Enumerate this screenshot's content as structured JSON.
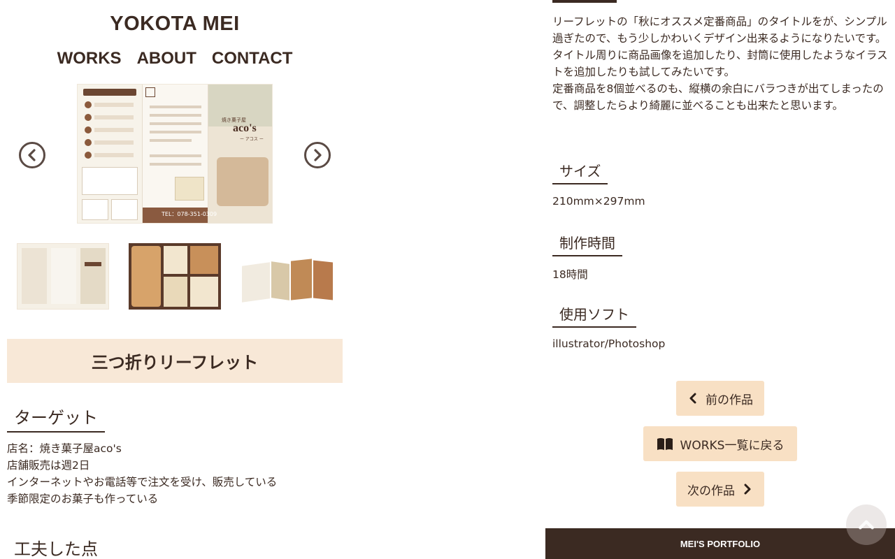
{
  "site": {
    "title": "YOKOTA MEI"
  },
  "nav": {
    "items": [
      {
        "label": "WORKS"
      },
      {
        "label": "ABOUT"
      },
      {
        "label": "CONTACT"
      }
    ]
  },
  "carousel": {
    "prev_icon": "chevron-left-icon",
    "next_icon": "chevron-right-icon",
    "main_image": {
      "shop_name": "aco's",
      "shop_sub": "焼き菓子屋",
      "shop_kana": "ー アコス ー",
      "tel": "TEL：078-351-0309"
    },
    "thumbnails": [
      {
        "name": "leaflet-outside"
      },
      {
        "name": "leaflet-inside"
      },
      {
        "name": "leaflet-folded"
      }
    ]
  },
  "work": {
    "title": "三つ折りリーフレット"
  },
  "target": {
    "heading": "ターゲット",
    "lines": [
      "店名：焼き菓子屋aco's",
      "店舗販売は週2日",
      "インターネットやお電話等で注文を受け、販売している",
      "季節限定のお菓子も作っている"
    ]
  },
  "ideas": {
    "heading": "工夫した点"
  },
  "description": {
    "paragraphs": [
      "リーフレットの「秋にオススメ定番商品」のタイトルをが、シンプル過ぎたので、もう少しかわいくデザイン出来るようになりたいです。",
      "タイトル周りに商品画像を追加したり、封筒に使用したようなイラストを追加したりも試してみたいです。",
      "定番商品を8個並べるのも、縦横の余白にバラつきが出てしまったので、調整したらより綺麗に並べることも出来たと思います。"
    ]
  },
  "specs": {
    "size": {
      "heading": "サイズ",
      "value": "210mm×297mm"
    },
    "time": {
      "heading": "制作時間",
      "value": "18時間"
    },
    "software": {
      "heading": "使用ソフト",
      "value": "illustrator/Photoshop"
    }
  },
  "buttons": {
    "prev": {
      "label": "前の作品",
      "icon": "chevron-left-icon"
    },
    "list": {
      "label": "WORKS一覧に戻る",
      "icon": "book-icon"
    },
    "next": {
      "label": "次の作品",
      "icon": "chevron-right-icon"
    }
  },
  "footer": {
    "text": "MEI'S PORTFOLIO"
  },
  "page_top": {
    "icon": "chevron-up-icon"
  },
  "colors": {
    "brown": "#3b2a22",
    "beige": "#f8e8d7",
    "button": "#f8e0c4"
  }
}
